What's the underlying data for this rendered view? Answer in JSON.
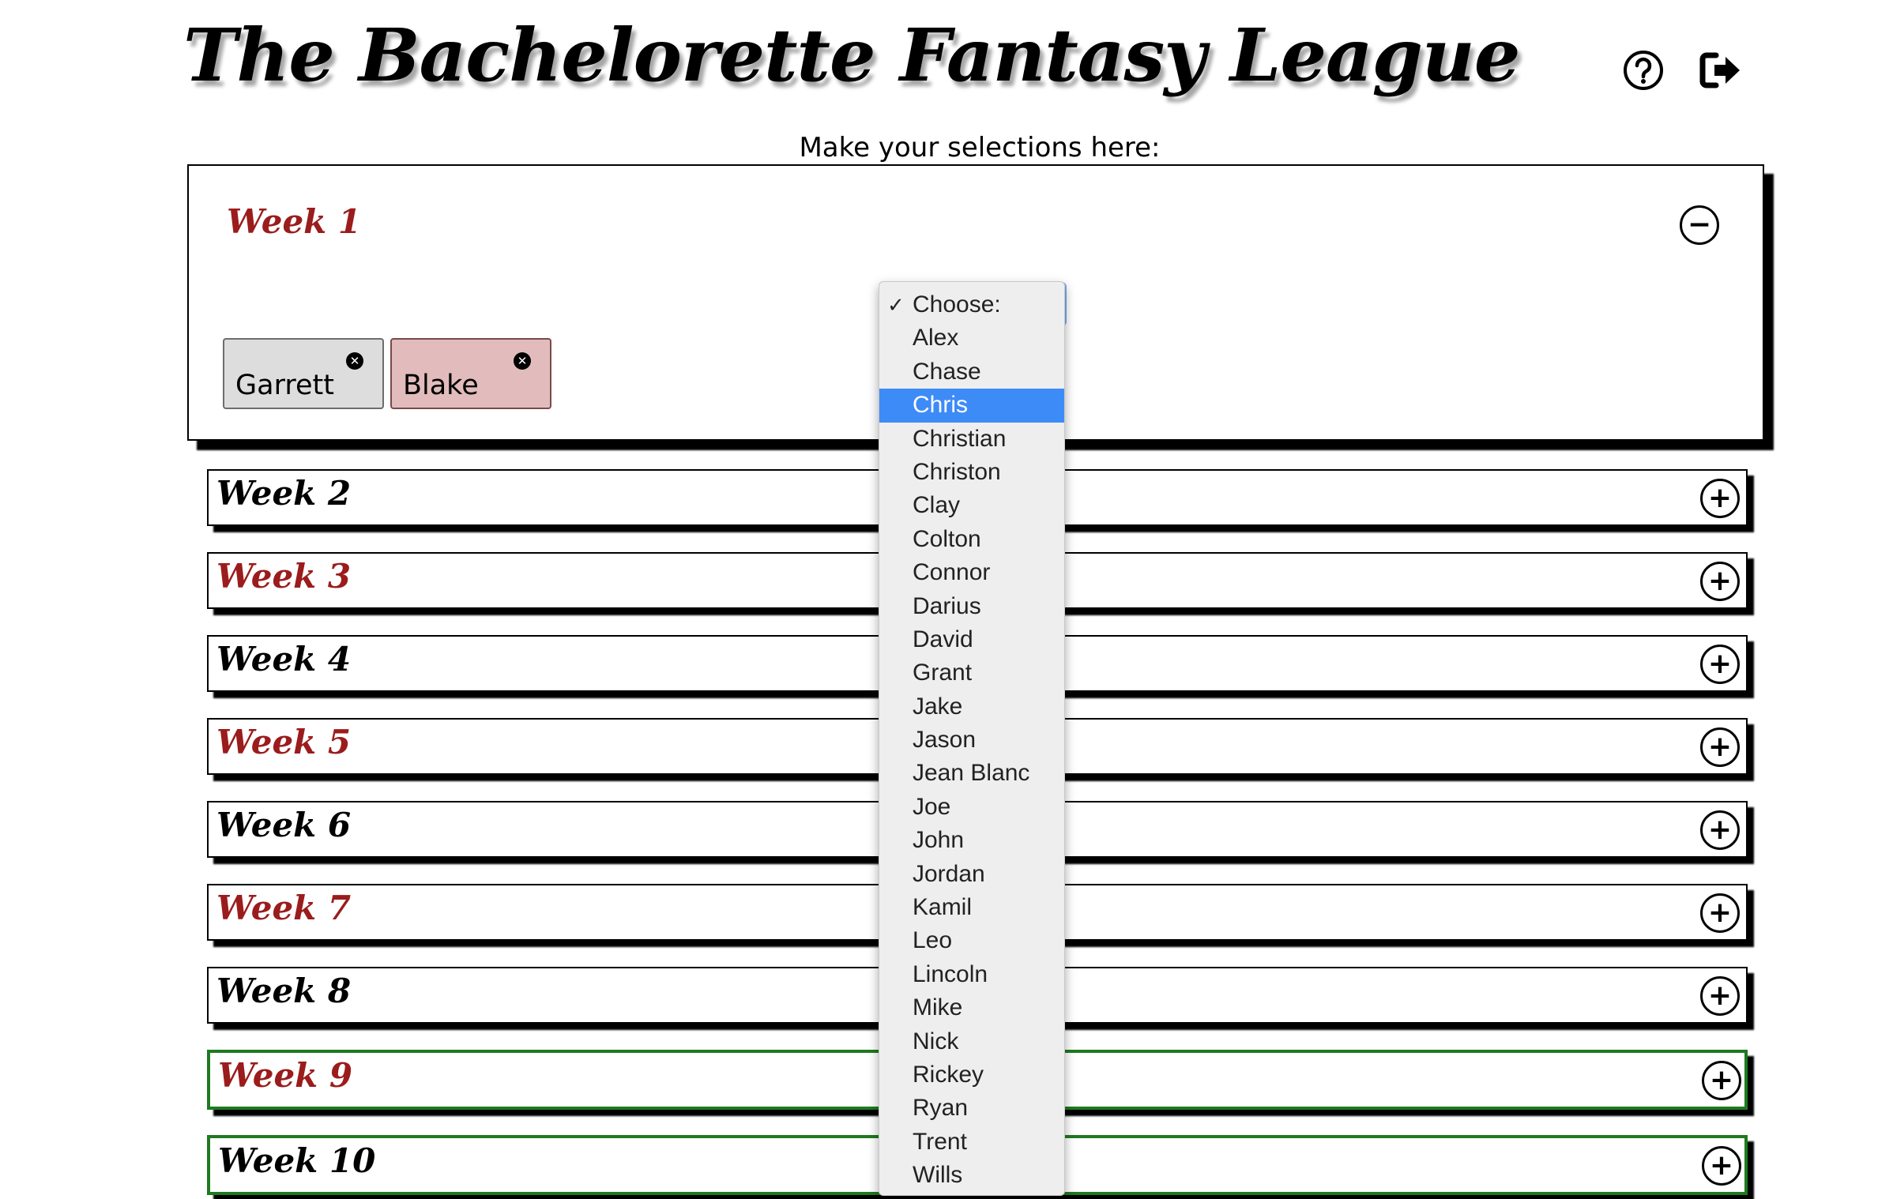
{
  "header": {
    "title": "The Bachelorette Fantasy League",
    "subtitle": "Make your selections here:",
    "help_icon": "question-circle-icon",
    "logout_icon": "sign-out-icon"
  },
  "week1": {
    "label": "Week 1",
    "toggle": "−",
    "chips": [
      {
        "name": "Garrett",
        "remove_icon": "close-icon"
      },
      {
        "name": "Blake",
        "remove_icon": "close-icon"
      }
    ]
  },
  "weeks": [
    {
      "label": "Week 2",
      "toggle": "+"
    },
    {
      "label": "Week 3",
      "toggle": "+"
    },
    {
      "label": "Week 4",
      "toggle": "+"
    },
    {
      "label": "Week 5",
      "toggle": "+"
    },
    {
      "label": "Week 6",
      "toggle": "+"
    },
    {
      "label": "Week 7",
      "toggle": "+"
    },
    {
      "label": "Week 8",
      "toggle": "+"
    },
    {
      "label": "Week 9",
      "toggle": "+"
    },
    {
      "label": "Week 10",
      "toggle": "+"
    }
  ],
  "dropdown": {
    "checkmark": "✓",
    "highlighted": "Chris",
    "options": [
      "Choose:",
      "Alex",
      "Chase",
      "Chris",
      "Christian",
      "Christon",
      "Clay",
      "Colton",
      "Connor",
      "Darius",
      "David",
      "Grant",
      "Jake",
      "Jason",
      "Jean Blanc",
      "Joe",
      "John",
      "Jordan",
      "Kamil",
      "Leo",
      "Lincoln",
      "Mike",
      "Nick",
      "Rickey",
      "Ryan",
      "Trent",
      "Wills"
    ]
  },
  "colors": {
    "accent_red": "#9b1c1c",
    "highlight_blue": "#3d8bf7",
    "green_border": "#1e7a1e"
  }
}
